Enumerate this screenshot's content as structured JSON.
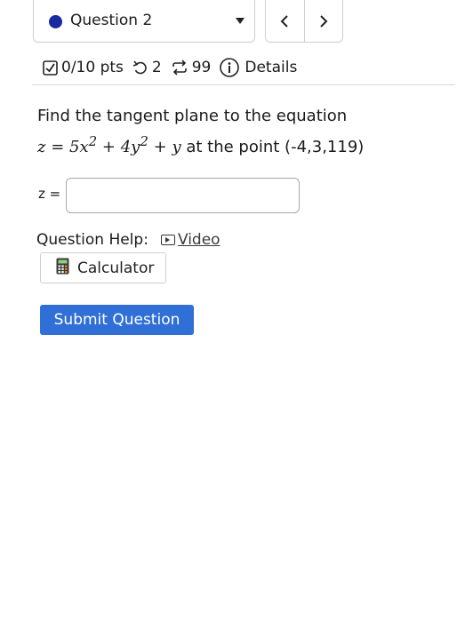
{
  "question_selector": {
    "label": "Question 2",
    "dot_color": "#1a2a9e"
  },
  "nav": {
    "prev_glyph": "‹",
    "next_glyph": "›"
  },
  "info_bar": {
    "points": "0/10 pts",
    "retries": "2",
    "attempts": "99",
    "details": "Details"
  },
  "problem": {
    "prompt": "Find the tangent plane to the equation",
    "eq_lhs": "z",
    "eq_rhs_a": "5x",
    "eq_rhs_b": "+ 4y",
    "eq_rhs_c": "+ y",
    "exp": "2",
    "suffix": "at the point (-4,3,119)"
  },
  "answer": {
    "label": "z =",
    "value": "",
    "placeholder": ""
  },
  "help": {
    "label": "Question Help:",
    "video": "Video"
  },
  "calculator": {
    "label": "Calculator"
  },
  "submit": {
    "label": "Submit Question",
    "color": "#2f6fd6"
  }
}
